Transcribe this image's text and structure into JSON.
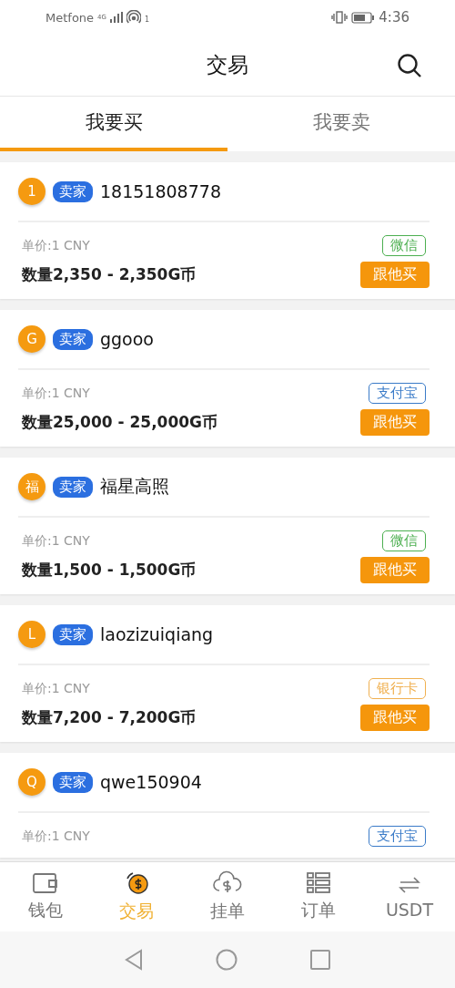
{
  "status_bar": {
    "carrier": "Metfone",
    "network": "4G",
    "hotspot_count": "1",
    "time": "4:36"
  },
  "header": {
    "title": "交易"
  },
  "tabs": [
    {
      "label": "我要买",
      "selected": true
    },
    {
      "label": "我要卖",
      "selected": false
    }
  ],
  "offers": [
    {
      "avatar": "1",
      "role": "卖家",
      "name": "18151808778",
      "price": "单价:1 CNY",
      "payment": "微信",
      "color": "#4caf50",
      "quantity": "数量2,350 - 2,350G币",
      "button": "跟他买"
    },
    {
      "avatar": "G",
      "role": "卖家",
      "name": "ggooo",
      "price": "单价:1 CNY",
      "payment": "支付宝",
      "color": "#3a7bc8",
      "quantity": "数量25,000 - 25,000G币",
      "button": "跟他买"
    },
    {
      "avatar": "福",
      "role": "卖家",
      "name": "福星高照",
      "price": "单价:1 CNY",
      "payment": "微信",
      "color": "#4caf50",
      "quantity": "数量1,500 - 1,500G币",
      "button": "跟他买"
    },
    {
      "avatar": "L",
      "role": "卖家",
      "name": "laozizuiqiang",
      "price": "单价:1 CNY",
      "payment": "银行卡",
      "color": "#f0b050",
      "quantity": "数量7,200 - 7,200G币",
      "button": "跟他买"
    },
    {
      "avatar": "Q",
      "role": "卖家",
      "name": "qwe150904",
      "price": "单价:1 CNY",
      "payment": "支付宝",
      "color": "#3a7bc8"
    }
  ],
  "bottom_nav": [
    {
      "kind": "wallet",
      "label": "钱包",
      "selected": false
    },
    {
      "kind": "trade",
      "label": "交易",
      "selected": true
    },
    {
      "kind": "cloud",
      "label": "挂单",
      "selected": false
    },
    {
      "kind": "orders",
      "label": "订单",
      "selected": false
    },
    {
      "kind": "exchange",
      "label": "USDT",
      "selected": false
    }
  ]
}
